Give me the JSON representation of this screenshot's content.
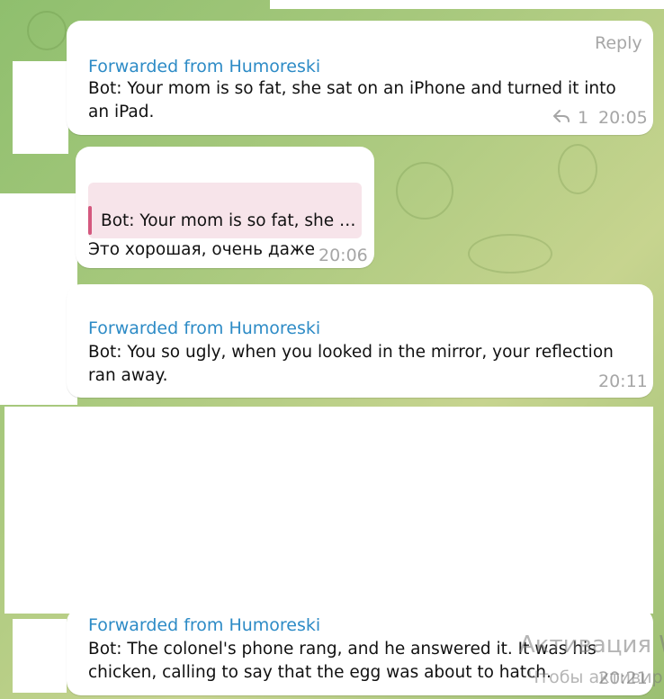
{
  "messages": [
    {
      "forwarded_label": "Forwarded from Humoreski",
      "text": "Bot: Your mom is so fat, she sat on an iPhone and turned it into an iPad.",
      "time": "20:05",
      "reply_label": "Reply",
      "reply_count": "1"
    },
    {
      "quote_text": "Bot: Your mom is so fat, she s…",
      "text": "Это хорошая, очень даже",
      "time": "20:06"
    },
    {
      "forwarded_label": "Forwarded from Humoreski",
      "text": "Bot: You so ugly, when you looked in the mirror, your reflection ran away.",
      "time": "20:11"
    },
    {
      "forwarded_label": "Forwarded from Humoreski",
      "text": "Bot: The colonel's phone rang, and he answered it. It was his chicken, calling to say that the egg was about to hatch.",
      "time": "20:21"
    }
  ],
  "watermark": {
    "line1": "Активация W",
    "line2": "Чтобы активир"
  },
  "colors": {
    "accent": "#2d8bc6",
    "quote_bar": "#d4587e",
    "quote_bg": "#f7e4ea",
    "meta": "#a6a6a6"
  },
  "icons": {
    "reply": "reply-arrow-icon"
  }
}
